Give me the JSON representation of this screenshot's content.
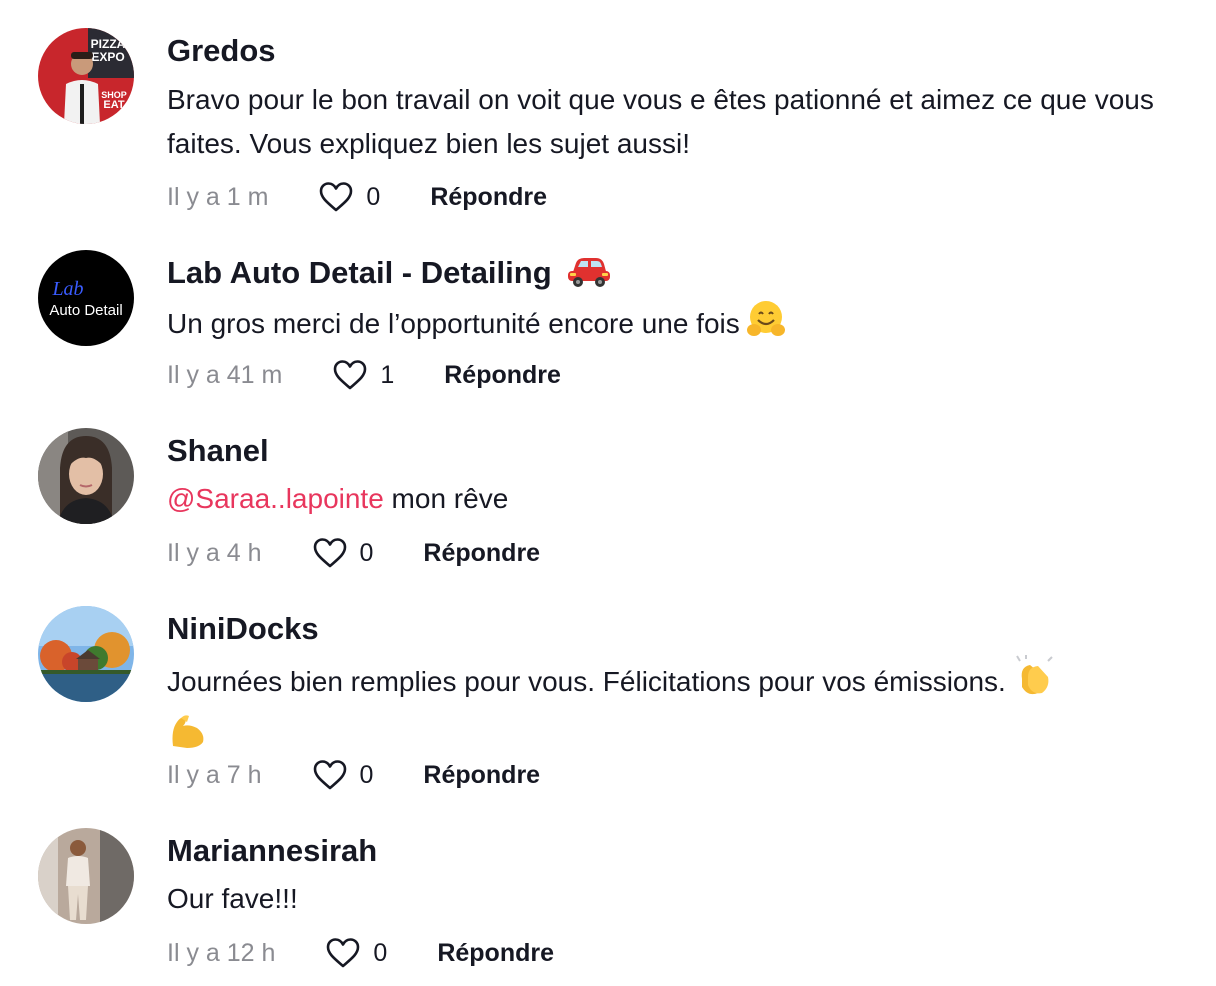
{
  "comments": [
    {
      "username": "Gredos",
      "text": "Bravo pour le bon travail on voit que vous e êtes pationné et aimez ce que vous faites. Vous expliquez bien les sujet aussi!",
      "time": "Il y a 1 m",
      "likes": "0",
      "reply_label": "Répondre",
      "avatar_text": [
        "PIZZA",
        "EXPO",
        "SHOP",
        "EAT"
      ]
    },
    {
      "username": "Lab Auto Detail - Detailing",
      "username_emoji": "red-car-emoji",
      "text": "Un gros merci de l’opportunité encore une fois",
      "text_emoji": "hugging-face-emoji",
      "time": "Il y a 41 m",
      "likes": "1",
      "reply_label": "Répondre",
      "avatar_text": [
        "Lab",
        "Auto Detail"
      ]
    },
    {
      "username": "Shanel",
      "mention": "@Saraa..lapointe",
      "text": " mon rêve",
      "time": "Il y a 4 h",
      "likes": "0",
      "reply_label": "Répondre"
    },
    {
      "username": "NiniDocks",
      "text": "Journées bien remplies pour vous. Félicitations pour vos émissions.",
      "text_emojis": [
        "clapping-hands-emoji",
        "flexed-biceps-emoji"
      ],
      "time": "Il y a 7 h",
      "likes": "0",
      "reply_label": "Répondre"
    },
    {
      "username": "Mariannesirah",
      "text": "Our fave!!!",
      "time": "Il y a 12 h",
      "likes": "0",
      "reply_label": "Répondre"
    }
  ],
  "colors": {
    "text": "#161823",
    "muted": "#8a8b91",
    "mention": "#e8365d"
  }
}
